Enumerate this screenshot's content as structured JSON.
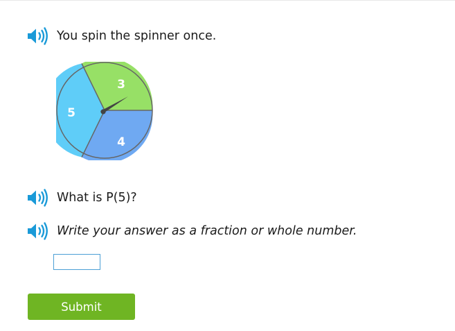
{
  "question": {
    "intro": "You spin the spinner once.",
    "prompt": "What is P(5)?",
    "instruction": "Write your answer as a fraction or whole number."
  },
  "spinner": {
    "sections": [
      {
        "label": "3",
        "color": "#97e066"
      },
      {
        "label": "4",
        "color": "#6fa9f2"
      },
      {
        "label": "5",
        "color": "#5fcdf8"
      }
    ],
    "needle_color": "#444444",
    "outline_color": "#666666"
  },
  "answer": {
    "value": ""
  },
  "submit": {
    "label": "Submit"
  },
  "colors": {
    "speaker": "#1a9ad8",
    "submit": "#6fb523",
    "input_border": "#4b9fd5"
  },
  "icons": {
    "audio": "speaker-icon"
  }
}
